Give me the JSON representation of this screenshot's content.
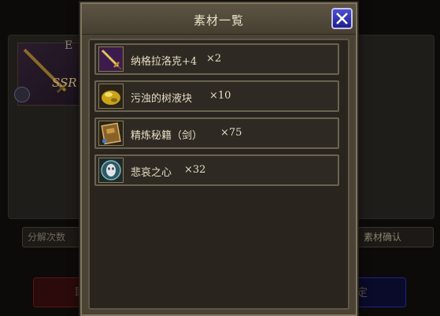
{
  "background": {
    "card_letter": "E",
    "card_rarity": "SSR",
    "left_field_label": "分解次数",
    "right_field_label": "素材确认",
    "left_button_label": "取",
    "right_button_label": "定"
  },
  "modal": {
    "title": "素材一覧",
    "close_icon": "close-x-icon",
    "accent_color": "#3a3fc8"
  },
  "items": [
    {
      "name": "纳格拉洛克+4",
      "qty": "×2",
      "icon": "sword-icon"
    },
    {
      "name": "污浊的树液块",
      "qty": "×10",
      "icon": "sap-blob-icon"
    },
    {
      "name": "精炼秘籍（剑）",
      "qty": "×75",
      "icon": "book-icon"
    },
    {
      "name": "悲哀之心",
      "qty": "×32",
      "icon": "mask-icon"
    }
  ]
}
